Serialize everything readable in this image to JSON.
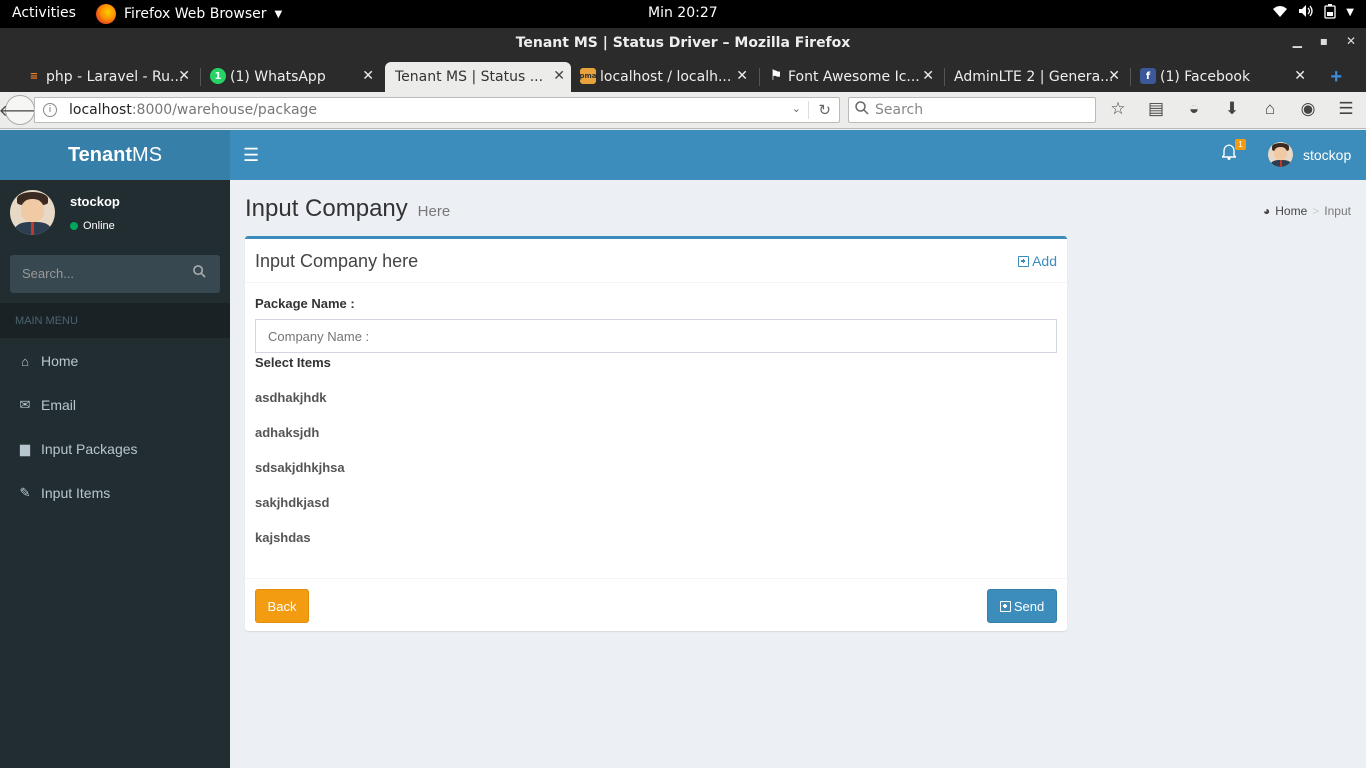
{
  "os": {
    "activities": "Activities",
    "app_name": "Firefox Web Browser",
    "clock": "Min 20:27",
    "tray_icons": [
      "wifi-icon",
      "volume-icon",
      "battery-icon"
    ]
  },
  "browser": {
    "window_title": "Tenant MS | Status Driver – Mozilla Firefox",
    "tabs": [
      {
        "label": "php - Laravel - Ru...",
        "icon": "stackoverflow-icon"
      },
      {
        "label": "(1) WhatsApp",
        "icon": "whatsapp-icon"
      },
      {
        "label": "Tenant MS | Status ...",
        "icon": "",
        "active": true
      },
      {
        "label": "localhost / localh...",
        "icon": "phpmyadmin-icon"
      },
      {
        "label": "Font Awesome Ic...",
        "icon": "flag-icon"
      },
      {
        "label": "AdminLTE 2 | Genera...",
        "icon": ""
      },
      {
        "label": "(1) Facebook",
        "icon": "facebook-icon"
      }
    ],
    "url_host": "localhost",
    "url_rest": ":8000/warehouse/package",
    "search_placeholder": "Search"
  },
  "app": {
    "logo_bold": "Tenant",
    "logo_rest": "MS",
    "notification_count": "1",
    "user_name": "stockop"
  },
  "sidebar": {
    "user_name": "stockop",
    "status": "Online",
    "search_placeholder": "Search...",
    "menu_header": "MAIN MENU",
    "items": [
      {
        "label": "Home",
        "icon": "home-icon"
      },
      {
        "label": "Email",
        "icon": "envelope-icon"
      },
      {
        "label": "Input Packages",
        "icon": "archive-icon"
      },
      {
        "label": "Input Items",
        "icon": "edit-icon"
      }
    ]
  },
  "content": {
    "title": "Input Company",
    "subtitle": "Here",
    "breadcrumb": {
      "home": "Home",
      "current": "Input"
    },
    "box_title": "Input Company here",
    "add_label": "Add",
    "package_label": "Package Name :",
    "input_placeholder": "Company Name :",
    "select_label": "Select Items",
    "items": [
      "asdhakjhdk",
      "adhaksjdh",
      "sdsakjdhkjhsa",
      "sakjhdkjasd",
      "kajshdas"
    ],
    "back_label": "Back",
    "send_label": "Send"
  }
}
